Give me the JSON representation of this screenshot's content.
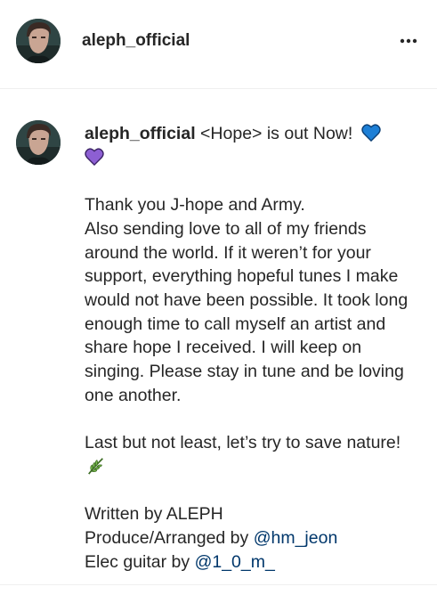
{
  "header": {
    "username": "aleph_official",
    "more_icon": "more-horizontal-icon"
  },
  "post": {
    "username": "aleph_official",
    "title_text": " <Hope> is out Now! ",
    "emojis": [
      "blue-heart-icon",
      "purple-heart-icon",
      "leaf-icon"
    ],
    "lines": [
      "Thank you J-hope and Army.",
      "Also sending love to all of my friends around the world. If it weren’t for your support, everything hopeful tunes I make would not have been possible. It took long enough time to call myself an artist and share hope I received. I will keep on singing. Please stay in tune and be loving one another."
    ],
    "closing": "Last but not least, let’s try to save nature!",
    "credits": {
      "written": "Written by ALEPH",
      "produce_prefix": "Produce/Arranged by ",
      "produce_mention": "@hm_jeon",
      "guitar_prefix": "Elec guitar by ",
      "guitar_mention": "@1_0_m_"
    }
  },
  "colors": {
    "text": "#262626",
    "mention": "#00376b",
    "blue_heart": "#1d7fd6",
    "purple_heart": "#8d5fd3",
    "leaf": "#6aa84f",
    "divider": "#efefef"
  }
}
